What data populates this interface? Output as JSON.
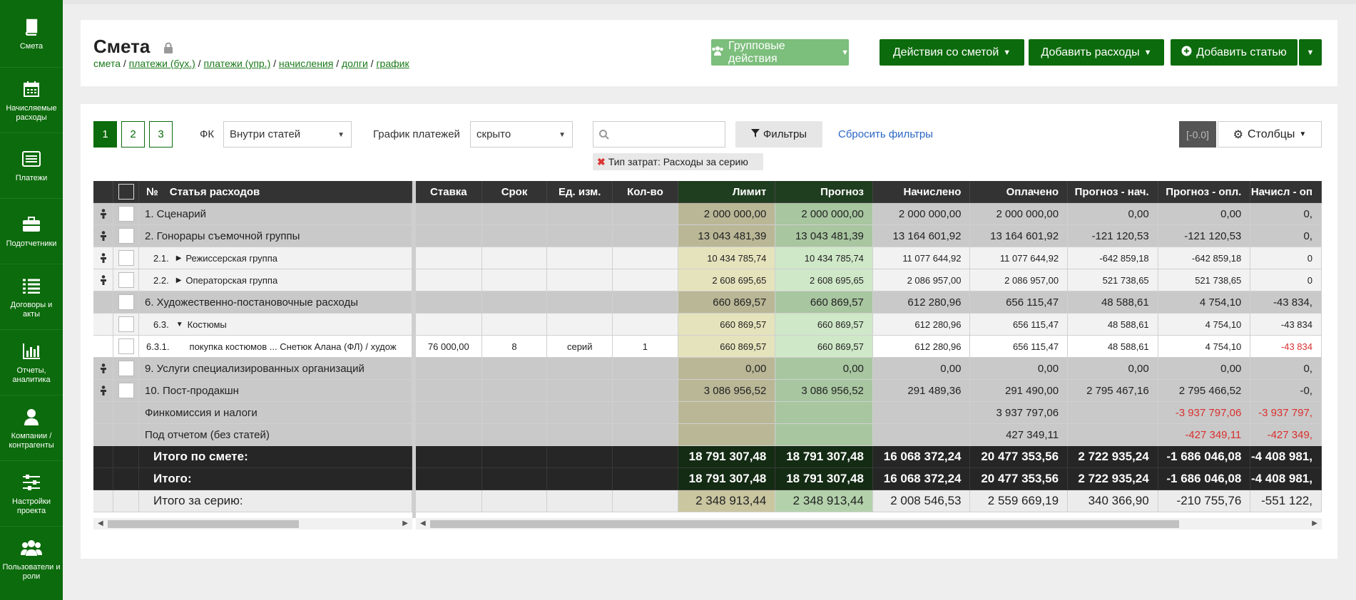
{
  "sidebar": {
    "items": [
      {
        "label": "Смета",
        "icon": "book-icon"
      },
      {
        "label": "Начисляемые расходы",
        "icon": "calendar-icon"
      },
      {
        "label": "Платежи",
        "icon": "list-box-icon"
      },
      {
        "label": "Подотчетники",
        "icon": "briefcase-icon"
      },
      {
        "label": "Договоры и акты",
        "icon": "list-icon"
      },
      {
        "label": "Отчеты, аналитика",
        "icon": "bar-chart-icon"
      },
      {
        "label": "Компании / контрагенты",
        "icon": "user-icon"
      },
      {
        "label": "Настройки проекта",
        "icon": "sliders-icon"
      },
      {
        "label": "Пользователи и роли",
        "icon": "users-icon"
      }
    ]
  },
  "header": {
    "title": "Смета",
    "breadcrumb": [
      {
        "label": "смета"
      },
      {
        "label": "платежи (бух.)"
      },
      {
        "label": "платежи (упр.)"
      },
      {
        "label": "начисления"
      },
      {
        "label": "долги"
      },
      {
        "label": "график"
      }
    ],
    "buttons": {
      "group": "Групповые действия",
      "smeta": "Действия со сметой",
      "expense": "Добавить расходы",
      "article": "Добавить статью"
    }
  },
  "toolbar": {
    "pages": [
      "1",
      "2",
      "3"
    ],
    "fk_label": "ФК",
    "fk_value": "Внутри статей",
    "schedule_label": "График платежей",
    "schedule_value": "скрыто",
    "search_placeholder": "",
    "filter_button": "Фильтры",
    "reset_filters": "Сбросить фильтры",
    "zoom_badge": "[-0.0]",
    "columns_button": "Столбцы",
    "active_filter_label": "Тип затрат:",
    "active_filter_value": "Расходы за серию"
  },
  "colors": {
    "brand": "#0c6b0c",
    "limit_col_bg": "#e5e3bc",
    "forecast_col_bg": "#cfe8c8",
    "negative": "#d9302e"
  },
  "table": {
    "left_headers": {
      "num": "№",
      "article": "Статья расходов"
    },
    "right_headers": [
      "Ставка",
      "Срок",
      "Ед. изм.",
      "Кол-во",
      "Лимит",
      "Прогноз",
      "Начислено",
      "Оплачено",
      "Прогноз - нач.",
      "Прогноз - опл.",
      "Начисл - оп"
    ],
    "rows": [
      {
        "level": 1,
        "person": true,
        "check": true,
        "num": "",
        "label": "1. Сценарий",
        "cells": [
          "",
          "",
          "",
          "",
          "2 000 000,00",
          "2 000 000,00",
          "2 000 000,00",
          "2 000 000,00",
          "0,00",
          "0,00",
          "0,"
        ]
      },
      {
        "level": 1,
        "person": true,
        "check": true,
        "num": "",
        "label": "2. Гонорары съемочной группы",
        "cells": [
          "",
          "",
          "",
          "",
          "13 043 481,39",
          "13 043 481,39",
          "13 164 601,92",
          "13 164 601,92",
          "-121 120,53",
          "-121 120,53",
          "0,"
        ]
      },
      {
        "level": 2,
        "person": true,
        "check": true,
        "num": "2.1.",
        "arrow": "right",
        "label": "Режиссерская группа",
        "cells": [
          "",
          "",
          "",
          "",
          "10 434 785,74",
          "10 434 785,74",
          "11 077 644,92",
          "11 077 644,92",
          "-642 859,18",
          "-642 859,18",
          "0"
        ]
      },
      {
        "level": 2,
        "person": true,
        "check": true,
        "num": "2.2.",
        "arrow": "right",
        "label": "Операторская группа",
        "cells": [
          "",
          "",
          "",
          "",
          "2 608 695,65",
          "2 608 695,65",
          "2 086 957,00",
          "2 086 957,00",
          "521 738,65",
          "521 738,65",
          "0"
        ]
      },
      {
        "level": 1,
        "person": false,
        "check": true,
        "num": "",
        "label": "6. Художественно-постановочные расходы",
        "cells": [
          "",
          "",
          "",
          "",
          "660 869,57",
          "660 869,57",
          "612 280,96",
          "656 115,47",
          "48 588,61",
          "4 754,10",
          "-43 834,"
        ]
      },
      {
        "level": 2,
        "person": false,
        "check": true,
        "num": "6.3.",
        "arrow": "down",
        "label": "Костюмы",
        "cells": [
          "",
          "",
          "",
          "",
          "660 869,57",
          "660 869,57",
          "612 280,96",
          "656 115,47",
          "48 588,61",
          "4 754,10",
          "-43 834"
        ]
      },
      {
        "level": 3,
        "person": false,
        "check": true,
        "num": "6.3.1.",
        "label": "покупка костюмов ... Снетюк Алана (ФЛ) / худож",
        "cells": [
          "76 000,00",
          "8",
          "серий",
          "1",
          "660 869,57",
          "660 869,57",
          "612 280,96",
          "656 115,47",
          "48 588,61",
          "4 754,10",
          "-43 834"
        ],
        "red_last": true
      },
      {
        "level": 1,
        "person": true,
        "check": true,
        "num": "",
        "label": "9. Услуги специализированных организаций",
        "cells": [
          "",
          "",
          "",
          "",
          "0,00",
          "0,00",
          "0,00",
          "0,00",
          "0,00",
          "0,00",
          "0,"
        ]
      },
      {
        "level": 1,
        "person": true,
        "check": true,
        "num": "",
        "label": "10. Пост-продакшн",
        "cells": [
          "",
          "",
          "",
          "",
          "3 086 956,52",
          "3 086 956,52",
          "291 489,36",
          "291 490,00",
          "2 795 467,16",
          "2 795 466,52",
          "-0,"
        ]
      },
      {
        "level": 1,
        "person": false,
        "check": false,
        "num": "",
        "label": "Финкомиссия и налоги",
        "cells": [
          "",
          "",
          "",
          "",
          "",
          "",
          "",
          "3 937 797,06",
          "",
          "-3 937 797,06",
          "-3 937 797,"
        ],
        "red_cols": [
          9,
          10
        ]
      },
      {
        "level": 1,
        "person": false,
        "check": false,
        "num": "",
        "label": "Под отчетом (без статей)",
        "cells": [
          "",
          "",
          "",
          "",
          "",
          "",
          "",
          "427 349,11",
          "",
          "-427 349,11",
          "-427 349,"
        ],
        "red_cols": [
          9,
          10
        ]
      }
    ],
    "totals": [
      {
        "style": "dark",
        "label": "Итого по смете:",
        "cells": [
          "",
          "",
          "",
          "",
          "18 791 307,48",
          "18 791 307,48",
          "16 068 372,24",
          "20 477 353,56",
          "2 722 935,24",
          "-1 686 046,08",
          "-4 408 981,"
        ]
      },
      {
        "style": "dark",
        "label": "Итого:",
        "cells": [
          "",
          "",
          "",
          "",
          "18 791 307,48",
          "18 791 307,48",
          "16 068 372,24",
          "20 477 353,56",
          "2 722 935,24",
          "-1 686 046,08",
          "-4 408 981,"
        ]
      },
      {
        "style": "light",
        "label": "Итого за серию:",
        "cells": [
          "",
          "",
          "",
          "",
          "2 348 913,44",
          "2 348 913,44",
          "2 008 546,53",
          "2 559 669,19",
          "340 366,90",
          "-210 755,76",
          "-551 122,"
        ]
      }
    ]
  }
}
